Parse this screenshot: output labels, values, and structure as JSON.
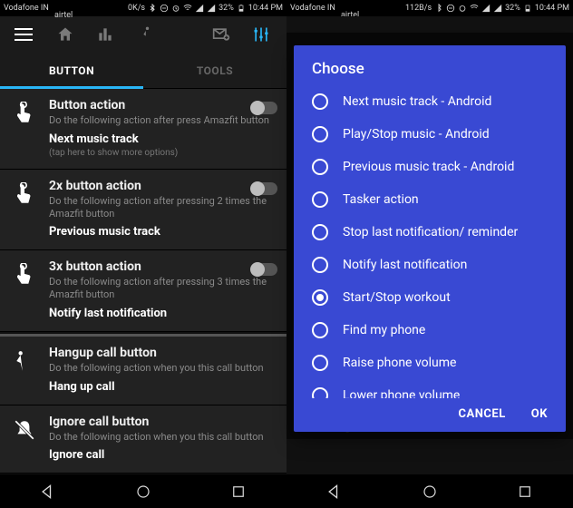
{
  "statusbar": {
    "carrier1": "Vodafone IN",
    "carrier2": "airtel",
    "speed_left": "0K/s",
    "speed_right": "112B/s",
    "battery": "32%",
    "time": "10:44 PM"
  },
  "tabs": {
    "button": "BUTTON",
    "tools": "TOOLS"
  },
  "cards": {
    "b1": {
      "title": "Button action",
      "desc": "Do the following action after press Amazfit button",
      "value": "Next music track",
      "hint": "(tap here to show more options)"
    },
    "b2": {
      "title": "2x button action",
      "desc": "Do the following action after pressing 2 times the Amazfit button",
      "value": "Previous music track"
    },
    "b3": {
      "title": "3x button action",
      "desc": "Do the following action after pressing 3 times the Amazfit button",
      "value": "Notify last notification"
    },
    "c1": {
      "title": "Hangup call button",
      "desc": "Do the following action when you this call button",
      "value": "Hang up call"
    },
    "c2": {
      "title": "Ignore call button",
      "desc": "Do the following action when you this call button",
      "value": "Ignore call"
    }
  },
  "dialog": {
    "title": "Choose",
    "options": [
      "Next music track - Android",
      "Play/Stop music - Android",
      "Previous music track - Android",
      "Tasker action",
      "Stop last notification/ reminder",
      "Notify last notification",
      "Start/Stop workout",
      "Find my phone",
      "Raise phone volume",
      "Lower phone volume"
    ],
    "selected_index": 6,
    "cancel": "CANCEL",
    "ok": "OK"
  },
  "ghost_label": "Ignore call"
}
